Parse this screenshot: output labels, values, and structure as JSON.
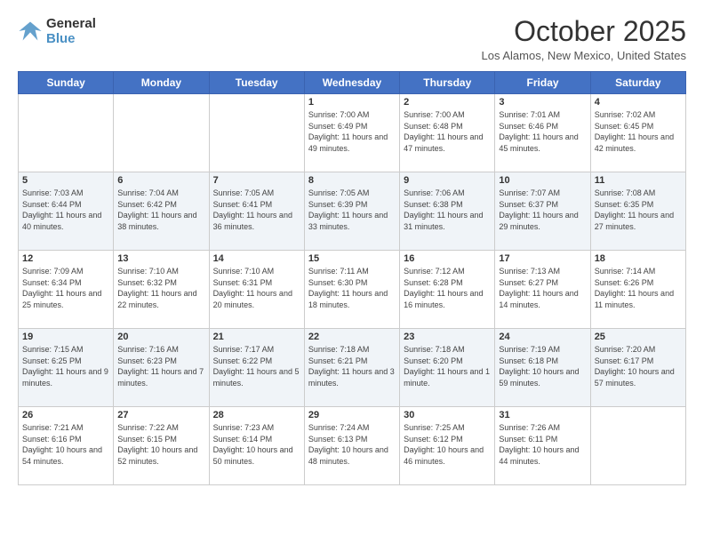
{
  "logo": {
    "line1": "General",
    "line2": "Blue"
  },
  "title": "October 2025",
  "location": "Los Alamos, New Mexico, United States",
  "days_of_week": [
    "Sunday",
    "Monday",
    "Tuesday",
    "Wednesday",
    "Thursday",
    "Friday",
    "Saturday"
  ],
  "weeks": [
    [
      {
        "day": "",
        "info": ""
      },
      {
        "day": "",
        "info": ""
      },
      {
        "day": "",
        "info": ""
      },
      {
        "day": "1",
        "info": "Sunrise: 7:00 AM\nSunset: 6:49 PM\nDaylight: 11 hours\nand 49 minutes."
      },
      {
        "day": "2",
        "info": "Sunrise: 7:00 AM\nSunset: 6:48 PM\nDaylight: 11 hours\nand 47 minutes."
      },
      {
        "day": "3",
        "info": "Sunrise: 7:01 AM\nSunset: 6:46 PM\nDaylight: 11 hours\nand 45 minutes."
      },
      {
        "day": "4",
        "info": "Sunrise: 7:02 AM\nSunset: 6:45 PM\nDaylight: 11 hours\nand 42 minutes."
      }
    ],
    [
      {
        "day": "5",
        "info": "Sunrise: 7:03 AM\nSunset: 6:44 PM\nDaylight: 11 hours\nand 40 minutes."
      },
      {
        "day": "6",
        "info": "Sunrise: 7:04 AM\nSunset: 6:42 PM\nDaylight: 11 hours\nand 38 minutes."
      },
      {
        "day": "7",
        "info": "Sunrise: 7:05 AM\nSunset: 6:41 PM\nDaylight: 11 hours\nand 36 minutes."
      },
      {
        "day": "8",
        "info": "Sunrise: 7:05 AM\nSunset: 6:39 PM\nDaylight: 11 hours\nand 33 minutes."
      },
      {
        "day": "9",
        "info": "Sunrise: 7:06 AM\nSunset: 6:38 PM\nDaylight: 11 hours\nand 31 minutes."
      },
      {
        "day": "10",
        "info": "Sunrise: 7:07 AM\nSunset: 6:37 PM\nDaylight: 11 hours\nand 29 minutes."
      },
      {
        "day": "11",
        "info": "Sunrise: 7:08 AM\nSunset: 6:35 PM\nDaylight: 11 hours\nand 27 minutes."
      }
    ],
    [
      {
        "day": "12",
        "info": "Sunrise: 7:09 AM\nSunset: 6:34 PM\nDaylight: 11 hours\nand 25 minutes."
      },
      {
        "day": "13",
        "info": "Sunrise: 7:10 AM\nSunset: 6:32 PM\nDaylight: 11 hours\nand 22 minutes."
      },
      {
        "day": "14",
        "info": "Sunrise: 7:10 AM\nSunset: 6:31 PM\nDaylight: 11 hours\nand 20 minutes."
      },
      {
        "day": "15",
        "info": "Sunrise: 7:11 AM\nSunset: 6:30 PM\nDaylight: 11 hours\nand 18 minutes."
      },
      {
        "day": "16",
        "info": "Sunrise: 7:12 AM\nSunset: 6:28 PM\nDaylight: 11 hours\nand 16 minutes."
      },
      {
        "day": "17",
        "info": "Sunrise: 7:13 AM\nSunset: 6:27 PM\nDaylight: 11 hours\nand 14 minutes."
      },
      {
        "day": "18",
        "info": "Sunrise: 7:14 AM\nSunset: 6:26 PM\nDaylight: 11 hours\nand 11 minutes."
      }
    ],
    [
      {
        "day": "19",
        "info": "Sunrise: 7:15 AM\nSunset: 6:25 PM\nDaylight: 11 hours\nand 9 minutes."
      },
      {
        "day": "20",
        "info": "Sunrise: 7:16 AM\nSunset: 6:23 PM\nDaylight: 11 hours\nand 7 minutes."
      },
      {
        "day": "21",
        "info": "Sunrise: 7:17 AM\nSunset: 6:22 PM\nDaylight: 11 hours\nand 5 minutes."
      },
      {
        "day": "22",
        "info": "Sunrise: 7:18 AM\nSunset: 6:21 PM\nDaylight: 11 hours\nand 3 minutes."
      },
      {
        "day": "23",
        "info": "Sunrise: 7:18 AM\nSunset: 6:20 PM\nDaylight: 11 hours\nand 1 minute."
      },
      {
        "day": "24",
        "info": "Sunrise: 7:19 AM\nSunset: 6:18 PM\nDaylight: 10 hours\nand 59 minutes."
      },
      {
        "day": "25",
        "info": "Sunrise: 7:20 AM\nSunset: 6:17 PM\nDaylight: 10 hours\nand 57 minutes."
      }
    ],
    [
      {
        "day": "26",
        "info": "Sunrise: 7:21 AM\nSunset: 6:16 PM\nDaylight: 10 hours\nand 54 minutes."
      },
      {
        "day": "27",
        "info": "Sunrise: 7:22 AM\nSunset: 6:15 PM\nDaylight: 10 hours\nand 52 minutes."
      },
      {
        "day": "28",
        "info": "Sunrise: 7:23 AM\nSunset: 6:14 PM\nDaylight: 10 hours\nand 50 minutes."
      },
      {
        "day": "29",
        "info": "Sunrise: 7:24 AM\nSunset: 6:13 PM\nDaylight: 10 hours\nand 48 minutes."
      },
      {
        "day": "30",
        "info": "Sunrise: 7:25 AM\nSunset: 6:12 PM\nDaylight: 10 hours\nand 46 minutes."
      },
      {
        "day": "31",
        "info": "Sunrise: 7:26 AM\nSunset: 6:11 PM\nDaylight: 10 hours\nand 44 minutes."
      },
      {
        "day": "",
        "info": ""
      }
    ]
  ]
}
